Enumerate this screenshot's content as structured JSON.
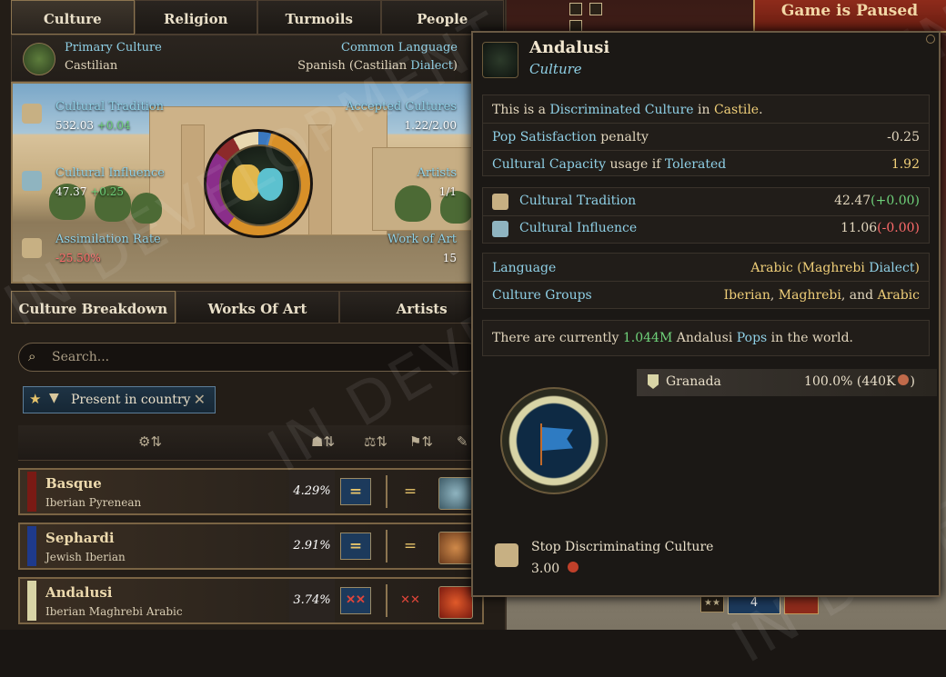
{
  "top_tabs": [
    "Culture",
    "Religion",
    "Turmoils",
    "People"
  ],
  "map_header": {
    "paused_text": "Game is Paused"
  },
  "culture_head": {
    "primary_label": "Primary Culture",
    "primary_value": "Castilian",
    "language_label": "Common Language",
    "language_value": "Spanish (Castilian ",
    "language_dialect": "Dialect",
    "language_close": ")"
  },
  "hero_stats": {
    "tradition_label": "Cultural Tradition",
    "tradition_value": "532.03",
    "tradition_delta": "+0.04",
    "influence_label": "Cultural Influence",
    "influence_value": "47.37",
    "influence_delta": "+0.25",
    "assimilation_label": "Assimilation Rate",
    "assimilation_value": "-25.50%",
    "accepted_label": "Accepted Cultures",
    "accepted_value": "1.22/2.00",
    "artists_label": "Artists",
    "artists_value": "1/1",
    "work_label": "Work of Art",
    "work_value": "15"
  },
  "sub_tabs": [
    "Culture Breakdown",
    "Works Of Art",
    "Artists"
  ],
  "search": {
    "placeholder": "Search..."
  },
  "filter_chip": {
    "label": "Present in country"
  },
  "culture_rows": [
    {
      "name": "Basque",
      "groups": "Iberian  Pyrenean",
      "pct": "4.29%",
      "action": "=",
      "relation": "=",
      "swatch": "#7a1a14"
    },
    {
      "name": "Sephardi",
      "groups": "Jewish  Iberian",
      "pct": "2.91%",
      "action": "=",
      "relation": "=",
      "swatch": "#1e3a8c"
    },
    {
      "name": "Andalusi",
      "groups": "Iberian  Maghrebi  Arabic",
      "pct": "3.74%",
      "action": "✕✕",
      "relation": "✕✕",
      "swatch": "#d8d4a6"
    }
  ],
  "tooltip": {
    "title": "Andalusi",
    "subtitle": "Culture",
    "status": {
      "pre": "This is a ",
      "status": "Discriminated Culture",
      "mid": " in ",
      "country": "Castile",
      "end": "."
    },
    "pop_sat": {
      "link": "Pop Satisfaction",
      "text": " penalty",
      "value": "-0.25"
    },
    "capacity": {
      "link": "Cultural Capacity",
      "mid": " usage if ",
      "link2": "Tolerated",
      "value": "1.92"
    },
    "tradition": {
      "label": "Cultural Tradition",
      "value": "42.47",
      "delta": "(+0.00)"
    },
    "influence": {
      "label": "Cultural Influence",
      "value": "11.06",
      "delta": "(-0.00)"
    },
    "language": {
      "label": "Language",
      "value": "Arabic (Maghrebi ",
      "dialect": "Dialect",
      "close": ")"
    },
    "groups": {
      "label": "Culture Groups",
      "g1": "Iberian",
      "sep1": ", ",
      "g2": "Maghrebi",
      "sep2": ", and ",
      "g3": "Arabic"
    },
    "pops": {
      "pre": "There are currently ",
      "count": "1.044M",
      "mid": " Andalusi ",
      "link": "Pops",
      "end": " in the world."
    },
    "location": {
      "name": "Granada",
      "value": "100.0% (440K",
      "close": ")"
    },
    "action": {
      "label": "Stop Discriminating Culture",
      "cost": "3.00"
    }
  },
  "map_footer": {
    "count": "4"
  },
  "watermark": "IN DEVELOPMENT",
  "colors": {
    "accent_cyan": "#8fd0e6",
    "gold": "#f0cf79",
    "positive": "#6fd27a",
    "negative": "#ff6b6b"
  }
}
